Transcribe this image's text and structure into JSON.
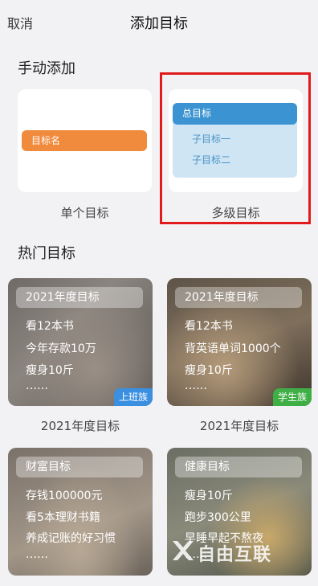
{
  "nav": {
    "cancel": "取消",
    "title": "添加目标"
  },
  "manual": {
    "section_title": "手动添加",
    "single": {
      "bar_label": "目标名",
      "caption": "单个目标"
    },
    "multi": {
      "head_label": "总目标",
      "sub1": "子目标一",
      "sub2": "子目标二",
      "caption": "多级目标"
    }
  },
  "hot": {
    "section_title": "热门目标",
    "cards": [
      {
        "tag": "2021年度目标",
        "lines": [
          "看12本书",
          "今年存款10万",
          "瘦身10斤",
          "……"
        ],
        "badge": "上班族",
        "badge_color": "#3b8fe0",
        "caption": "2021年度目标"
      },
      {
        "tag": "2021年度目标",
        "lines": [
          "看12本书",
          "背英语单词1000个",
          "瘦身10斤",
          "……"
        ],
        "badge": "学生族",
        "badge_color": "#3fae45",
        "caption": "2021年度目标"
      },
      {
        "tag": "财富目标",
        "lines": [
          "存钱100000元",
          "看5本理财书籍",
          "养成记账的好习惯",
          "……"
        ]
      },
      {
        "tag": "健康目标",
        "lines": [
          "瘦身10斤",
          "跑步300公里",
          "早睡早起不熬夜",
          "……"
        ]
      }
    ]
  },
  "watermark": "自由互联"
}
